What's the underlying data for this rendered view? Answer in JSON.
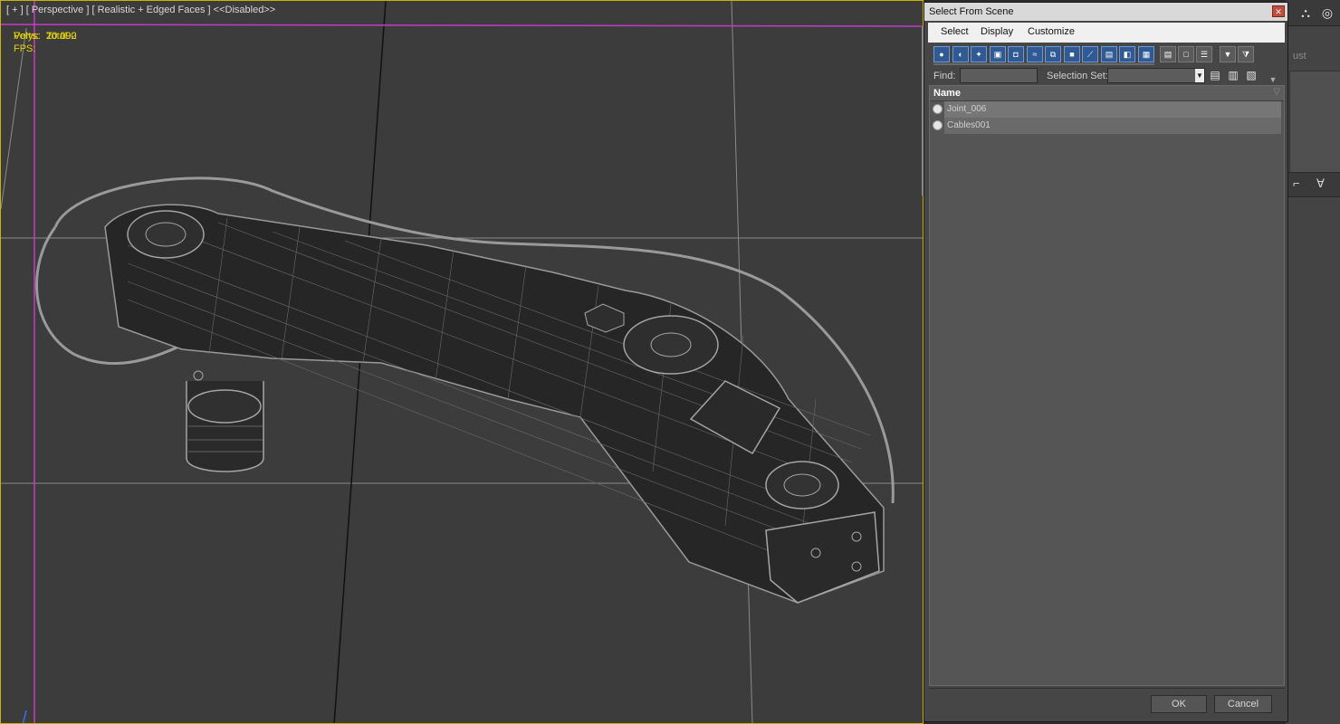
{
  "viewport": {
    "label": "[ + ] [ Perspective ] [ Realistic + Edged Faces ] <<Disabled>>",
    "stats": {
      "total_label": "Total",
      "polys_label": "Polys:",
      "polys_value": "20 090",
      "verts_label": "Verts:",
      "verts_value": "20 092",
      "fps_label": "FPS:"
    }
  },
  "dialog": {
    "title": "Select From Scene",
    "close_glyph": "✕",
    "menus": [
      "Select",
      "Display",
      "Customize"
    ],
    "find_label": "Find:",
    "find_value": "",
    "selection_set_label": "Selection Set:",
    "selection_set_value": "",
    "column_header": "Name",
    "items": [
      {
        "name": "Joint_006"
      },
      {
        "name": "Cables001"
      }
    ],
    "ok_label": "OK",
    "cancel_label": "Cancel"
  },
  "side_panel": {
    "partial_text": "ust"
  }
}
